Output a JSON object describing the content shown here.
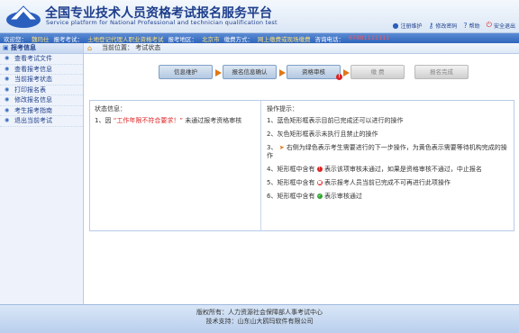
{
  "header": {
    "title": "全国专业技术人员资格考试报名服务平台",
    "subtitle": "Service platform for National Professional and technician qualification test",
    "links": [
      {
        "label": "注册维护",
        "icon": "user-icon"
      },
      {
        "label": "修改密码",
        "icon": "key-icon"
      },
      {
        "label": "帮助",
        "icon": "help-icon"
      },
      {
        "label": "安全退出",
        "icon": "power-icon"
      }
    ]
  },
  "infobar": {
    "welcome_label": "欢迎您：",
    "welcome_name": "魏玛仕",
    "exam_label": "报考考试：",
    "exam_value": "土地登记代理人职业资格考试",
    "area_label": "报考地区：",
    "area_value": "北京市",
    "fee_label": "缴费方式：",
    "fee_value": "网上缴费或现场缴费",
    "phone_label": "咨询电话：",
    "phone_value": "67881111111"
  },
  "sidebar": {
    "title": "报考信息",
    "items": [
      {
        "label": "查看考试文件"
      },
      {
        "label": "查看报考信息"
      },
      {
        "label": "当前报考状态"
      },
      {
        "label": "打印报名表"
      },
      {
        "label": "修改报名信息"
      },
      {
        "label": "考生报考指南"
      },
      {
        "label": "退出当前考试"
      }
    ]
  },
  "breadcrumb": {
    "label": "当前位置：",
    "value": "考试状态"
  },
  "steps": [
    {
      "label": "信息维护",
      "state": "active",
      "arrow": true,
      "badge": ""
    },
    {
      "label": "报名信息确认",
      "state": "active",
      "arrow": true,
      "badge": ""
    },
    {
      "label": "资格审核",
      "state": "active",
      "arrow": true,
      "badge": "!"
    },
    {
      "label": "缴 费",
      "state": "inactive",
      "arrow": false,
      "badge": ""
    },
    {
      "label": "报名完成",
      "state": "inactive",
      "arrow": false,
      "badge": ""
    }
  ],
  "status": {
    "label": "状态信息：",
    "line_prefix": "1、因",
    "reason": "“工作年限不符合要求！”",
    "line_suffix": "未通过报考资格审核"
  },
  "ops": {
    "label": "操作提示：",
    "items": [
      "1、蓝色矩形框表示目前已完成还可以进行的操作",
      "2、灰色矩形框表示未执行且禁止的操作",
      "右侧为绿色表示考生需要进行的下一步操作，为黄色表示需要等待机构完成的操作",
      "表示该项审核未通过，如果是资格审核不通过，中止报名",
      "表示报考人员当前已完成不可再进行此项操作",
      "表示审核通过"
    ],
    "prefix3": "3、",
    "prefix4": "4、矩形框中含有",
    "prefix5": "5、矩形框中含有",
    "prefix6": "6、矩形框中含有"
  },
  "footer": {
    "owner": "版权所有：人力资源社会保障部人事考试中心",
    "support": "技术支持：山东山大鸥玛软件有限公司"
  },
  "colors": {
    "accent": "#2f66bc",
    "warning": "#d22222",
    "orange": "#e07818"
  }
}
